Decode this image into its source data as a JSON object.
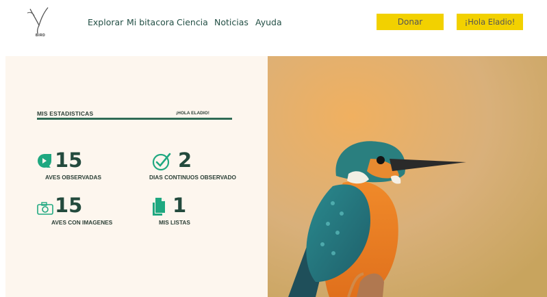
{
  "brand": {
    "logo_text": "BIRD"
  },
  "nav": {
    "items": [
      {
        "label": "Explorar"
      },
      {
        "label": "Mi bitacora"
      },
      {
        "label": "Ciencia"
      },
      {
        "label": "Noticias"
      },
      {
        "label": "Ayuda"
      }
    ]
  },
  "header_buttons": {
    "donate": "Donar",
    "greeting": "¡Hola Eladio!"
  },
  "stats": {
    "title": "MIS ESTADISTICAS",
    "hello": "¡HOLA ELADIO!",
    "items": [
      {
        "value": "15",
        "label": "AVES OBSERVADAS",
        "icon": "bird-icon"
      },
      {
        "value": "2",
        "label": "DIAS CONTINUOS OBSERVADO",
        "icon": "check-circle-icon"
      },
      {
        "value": "15",
        "label": "AVES CON IMAGENES",
        "icon": "camera-icon"
      },
      {
        "value": "1",
        "label": "MIS LISTAS",
        "icon": "document-icon"
      }
    ]
  },
  "colors": {
    "accent_yellow": "#f2d100",
    "brand_green": "#234a3d",
    "icon_green": "#1fa880",
    "panel_bg": "#fdf6ee"
  }
}
